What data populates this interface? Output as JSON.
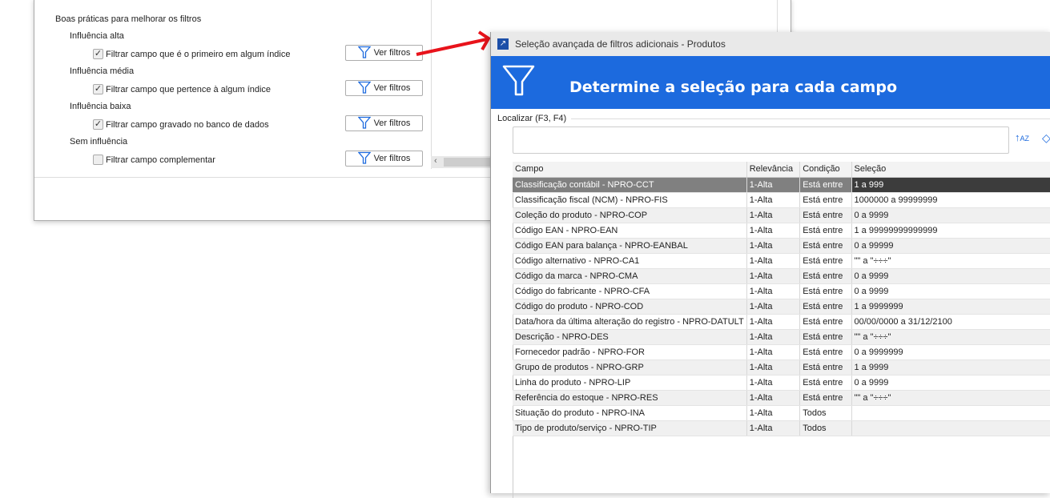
{
  "background": {
    "section_title": "Boas práticas para melhorar os filtros",
    "groups": [
      {
        "label": "Influência alta",
        "option": "Filtrar campo que é o primeiro em algum índice",
        "checked": true,
        "button": "Ver filtros"
      },
      {
        "label": "Influência média",
        "option": "Filtrar campo que pertence à algum índice",
        "checked": true,
        "button": "Ver filtros"
      },
      {
        "label": "Influência baixa",
        "option": "Filtrar campo gravado no banco de dados",
        "checked": true,
        "button": "Ver filtros"
      },
      {
        "label": "Sem influência",
        "option": "Filtrar campo complementar",
        "checked": false,
        "button": "Ver filtros"
      }
    ]
  },
  "dialog": {
    "title": "Seleção avançada de filtros adicionais - Produtos",
    "header": "Determine a seleção para cada campo",
    "search_label": "Localizar (F3, F4)",
    "search_value": "",
    "accent": "#1c6ade",
    "columns": [
      "Campo",
      "Relevância",
      "Condição",
      "Seleção"
    ],
    "rows": [
      [
        "Classificação contábil - NPRO-CCT",
        "1-Alta",
        "Está entre",
        "1 a 999"
      ],
      [
        "Classificação fiscal (NCM) - NPRO-FIS",
        "1-Alta",
        "Está entre",
        "1000000 a 99999999"
      ],
      [
        "Coleção do produto - NPRO-COP",
        "1-Alta",
        "Está entre",
        "0 a 9999"
      ],
      [
        "Código EAN - NPRO-EAN",
        "1-Alta",
        "Está entre",
        "1 a 99999999999999"
      ],
      [
        "Código EAN para balança - NPRO-EANBAL",
        "1-Alta",
        "Está entre",
        "0 a 99999"
      ],
      [
        "Código alternativo - NPRO-CA1",
        "1-Alta",
        "Está entre",
        "\"\" a \"÷÷÷\""
      ],
      [
        "Código da marca - NPRO-CMA",
        "1-Alta",
        "Está entre",
        "0 a 9999"
      ],
      [
        "Código do fabricante - NPRO-CFA",
        "1-Alta",
        "Está entre",
        "0 a 9999"
      ],
      [
        "Código do produto - NPRO-COD",
        "1-Alta",
        "Está entre",
        "1 a 9999999"
      ],
      [
        "Data/hora da última alteração do registro - NPRO-DATULT",
        "1-Alta",
        "Está entre",
        "00/00/0000 a 31/12/2100"
      ],
      [
        "Descrição - NPRO-DES",
        "1-Alta",
        "Está entre",
        "\"\" a \"÷÷÷\""
      ],
      [
        "Fornecedor padrão - NPRO-FOR",
        "1-Alta",
        "Está entre",
        "0 a 9999999"
      ],
      [
        "Grupo de produtos - NPRO-GRP",
        "1-Alta",
        "Está entre",
        "1 a 9999"
      ],
      [
        "Linha do produto - NPRO-LIP",
        "1-Alta",
        "Está entre",
        "0 a 9999"
      ],
      [
        "Referência do estoque - NPRO-RES",
        "1-Alta",
        "Está entre",
        "\"\" a \"÷÷÷\""
      ],
      [
        "Situação do produto - NPRO-INA",
        "1-Alta",
        "Todos",
        ""
      ],
      [
        "Tipo de produto/serviço - NPRO-TIP",
        "1-Alta",
        "Todos",
        ""
      ]
    ]
  }
}
